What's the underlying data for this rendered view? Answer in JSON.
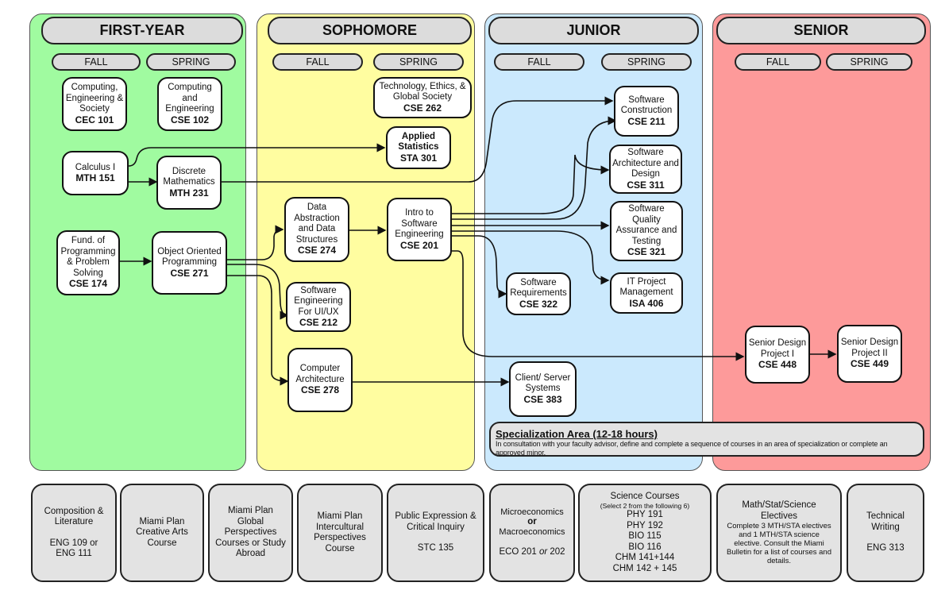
{
  "years": [
    {
      "id": "first-year",
      "label": "FIRST-YEAR",
      "color": "#a0fba0"
    },
    {
      "id": "sophomore",
      "label": "SOPHOMORE",
      "color": "#fffda0"
    },
    {
      "id": "junior",
      "label": "JUNIOR",
      "color": "#cbe9fd"
    },
    {
      "id": "senior",
      "label": "SENIOR",
      "color": "#fd9a9a"
    }
  ],
  "semesters": {
    "fall": "FALL",
    "spring": "SPRING"
  },
  "courses": {
    "cec101": {
      "name": "Computing, Engineering & Society",
      "code": "CEC 101"
    },
    "cse102": {
      "name": "Computing and Engineering",
      "code": "CSE 102"
    },
    "mth151": {
      "name": "Calculus I",
      "code": "MTH 151"
    },
    "mth231": {
      "name": "Discrete Mathematics",
      "code": "MTH 231"
    },
    "cse174": {
      "name": "Fund. of Programming & Problem Solving",
      "code": "CSE 174"
    },
    "cse271": {
      "name": "Object Oriented Programming",
      "code": "CSE 271"
    },
    "cse262": {
      "name": "Technology, Ethics, & Global Society",
      "code": "CSE 262"
    },
    "sta301": {
      "name": "Applied Statistics",
      "code": "STA 301"
    },
    "cse274": {
      "name": "Data Abstraction and Data Structures",
      "code": "CSE 274"
    },
    "cse201": {
      "name": "Intro to Software Engineering",
      "code": "CSE 201"
    },
    "cse212": {
      "name": "Software Engineering For UI/UX",
      "code": "CSE 212"
    },
    "cse278": {
      "name": "Computer Architecture",
      "code": "CSE 278"
    },
    "cse211": {
      "name": "Software Construction",
      "code": "CSE 211"
    },
    "cse311": {
      "name": "Software Architecture and Design",
      "code": "CSE 311"
    },
    "cse321": {
      "name": "Software Quality Assurance and Testing",
      "code": "CSE 321"
    },
    "cse322": {
      "name": "Software Requirements",
      "code": "CSE 322"
    },
    "isa406": {
      "name": "IT Project Management",
      "code": "ISA 406"
    },
    "cse383": {
      "name": "Client/ Server Systems",
      "code": "CSE 383"
    },
    "cse448": {
      "name": "Senior Design Project I",
      "code": "CSE 448"
    },
    "cse449": {
      "name": "Senior Design Project II",
      "code": "CSE 449"
    }
  },
  "prerequisites": [
    [
      "mth151",
      "mth231"
    ],
    [
      "mth151",
      "sta301"
    ],
    [
      "cse174",
      "cse271"
    ],
    [
      "cse271",
      "cse274"
    ],
    [
      "cse271",
      "cse212"
    ],
    [
      "cse271",
      "cse278"
    ],
    [
      "cse274",
      "cse201"
    ],
    [
      "mth231",
      "cse211"
    ],
    [
      "cse201",
      "cse211"
    ],
    [
      "cse201",
      "cse311"
    ],
    [
      "cse201",
      "cse321"
    ],
    [
      "cse201",
      "cse322"
    ],
    [
      "cse201",
      "isa406"
    ],
    [
      "cse201",
      "cse448"
    ],
    [
      "cse278",
      "cse383"
    ],
    [
      "cse448",
      "cse449"
    ]
  ],
  "specialization": {
    "title": "Specialization Area (12-18 hours)",
    "description": "In consultation with your faculty advisor, define and complete a sequence of courses in an area of specialization or complete an approved minor."
  },
  "general": {
    "composition": {
      "l1": "Composition &",
      "l2": "Literature",
      "l3": "ENG 109 or",
      "l4": "ENG 111"
    },
    "creative": {
      "l1": "Miami Plan",
      "l2": "Creative Arts",
      "l3": "Course"
    },
    "global": {
      "l1": "Miami Plan",
      "l2": "Global",
      "l3": "Perspectives",
      "l4": "Courses or Study",
      "l5": "Abroad"
    },
    "intercultural": {
      "l1": "Miami Plan",
      "l2": "Intercultural",
      "l3": "Perspectives",
      "l4": "Course"
    },
    "public": {
      "l1": "Public Expression &",
      "l2": "Critical Inquiry",
      "l3": "STC 135"
    },
    "econ": {
      "l1": "Microeconomics",
      "or": "or",
      "l2": "Macroeconomics",
      "l3a": "ECO 201 ",
      "l3b": "or",
      "l3c": " 202"
    },
    "science": {
      "title": "Science Courses",
      "note": "(Select 2 from the following 6)",
      "items": [
        "PHY 191",
        "PHY 192",
        "BIO 115",
        "BIO 116",
        "CHM 141+144",
        "CHM 142 + 145"
      ]
    },
    "electives": {
      "l1": "Math/Stat/Science",
      "l2": "Electives",
      "desc": "Complete 3 MTH/STA electives and 1 MTH/STA science elective. Consult the Miami Bulletin for a list of courses and details."
    },
    "techwriting": {
      "l1": "Technical",
      "l2": "Writing",
      "l3": "ENG 313"
    }
  }
}
